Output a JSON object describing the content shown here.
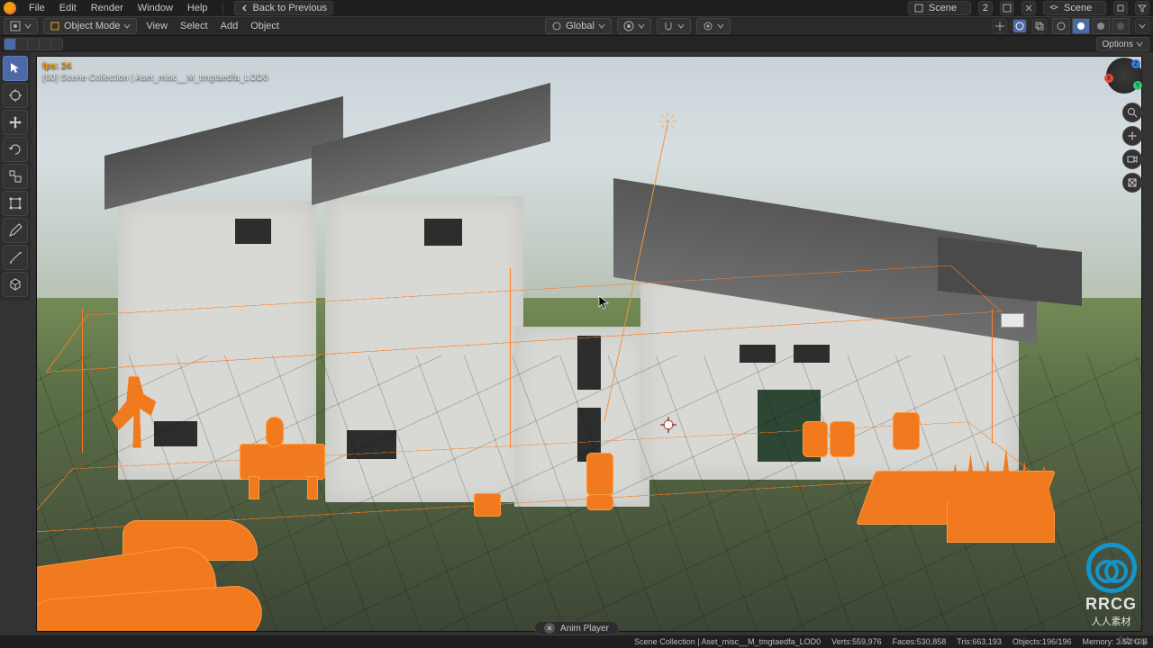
{
  "menu": {
    "items": [
      "File",
      "Edit",
      "Render",
      "Window",
      "Help"
    ],
    "back_label": "Back to Previous"
  },
  "header_right": {
    "scene_label": "Scene",
    "layer_label": "Scene",
    "number": "2"
  },
  "toolbar": {
    "mode": "Object Mode",
    "links": [
      "View",
      "Select",
      "Add",
      "Object"
    ],
    "orientation": "Global",
    "options_label": "Options"
  },
  "viewport_overlay": {
    "fps": "fps: 24",
    "path": "(60) Scene Collection | Aset_misc__M_tmgtaedfa_LOD0"
  },
  "anim_player": "Anim Player",
  "status": {
    "left": "Scene Collection | Aset_misc__M_tmgtaedfa_LOD0",
    "verts": "Verts:559,976",
    "faces": "Faces:530,858",
    "tris": "Tris:663,193",
    "objects": "Objects:196/196",
    "memory": "Memory: 3.52 GiB"
  },
  "watermarks": {
    "udemy": "ûdemy",
    "rrcg_big": "RRCG",
    "rrcg_sub": "人人素材"
  },
  "nav_axes": {
    "x": "X",
    "y": "Y",
    "z": "Z"
  }
}
